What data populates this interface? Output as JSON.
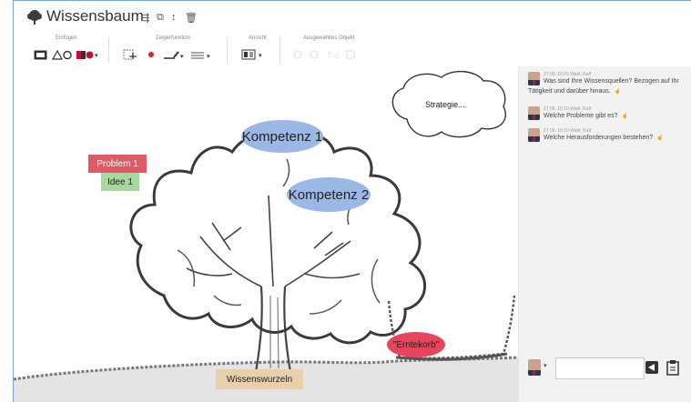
{
  "app": {
    "title": "Wissensbaum"
  },
  "toolbar_icons": [
    "share-icon",
    "copy-icon",
    "sort-icon",
    "trash-icon"
  ],
  "ribbon": {
    "groups": [
      {
        "label": "Einfügen"
      },
      {
        "label": "Zeigerfunktion"
      },
      {
        "label": "Ansicht"
      },
      {
        "label": "Ausgewähltes Objekt"
      }
    ]
  },
  "canvas": {
    "labels": {
      "kompetenz1": "Kompetenz 1",
      "kompetenz2": "Kompetenz 2",
      "strategie": "Strategie....",
      "problem1": "Problem 1",
      "idee1": "Idee 1",
      "erntekorb": "\"Erntekorb\"",
      "wissenswurzeln": "Wissenswurzeln"
    },
    "colors": {
      "kompetenz": "#9ab7e6",
      "problem": "#e05a66",
      "idee": "#a8d8a0",
      "erntekorb": "#e8445a",
      "wurzeln": "#e9cfaa"
    }
  },
  "chat": {
    "messages": [
      {
        "meta": "27.09. 16:03 Wahl, Ralf",
        "line1": "Was sind Ihre Wissensquellen? Bezogen auf Ihr",
        "line2": "Tätigkeit und darüber hinaus."
      },
      {
        "meta": "27.09. 16:10 Wahl, Ralf",
        "line1": "Welche Probleme gibt es?"
      },
      {
        "meta": "27.09. 16:10 Wahl, Ralf",
        "line1": "Welche Herausforderungen bestehen?"
      }
    ],
    "composer": {
      "placeholder": ""
    }
  }
}
